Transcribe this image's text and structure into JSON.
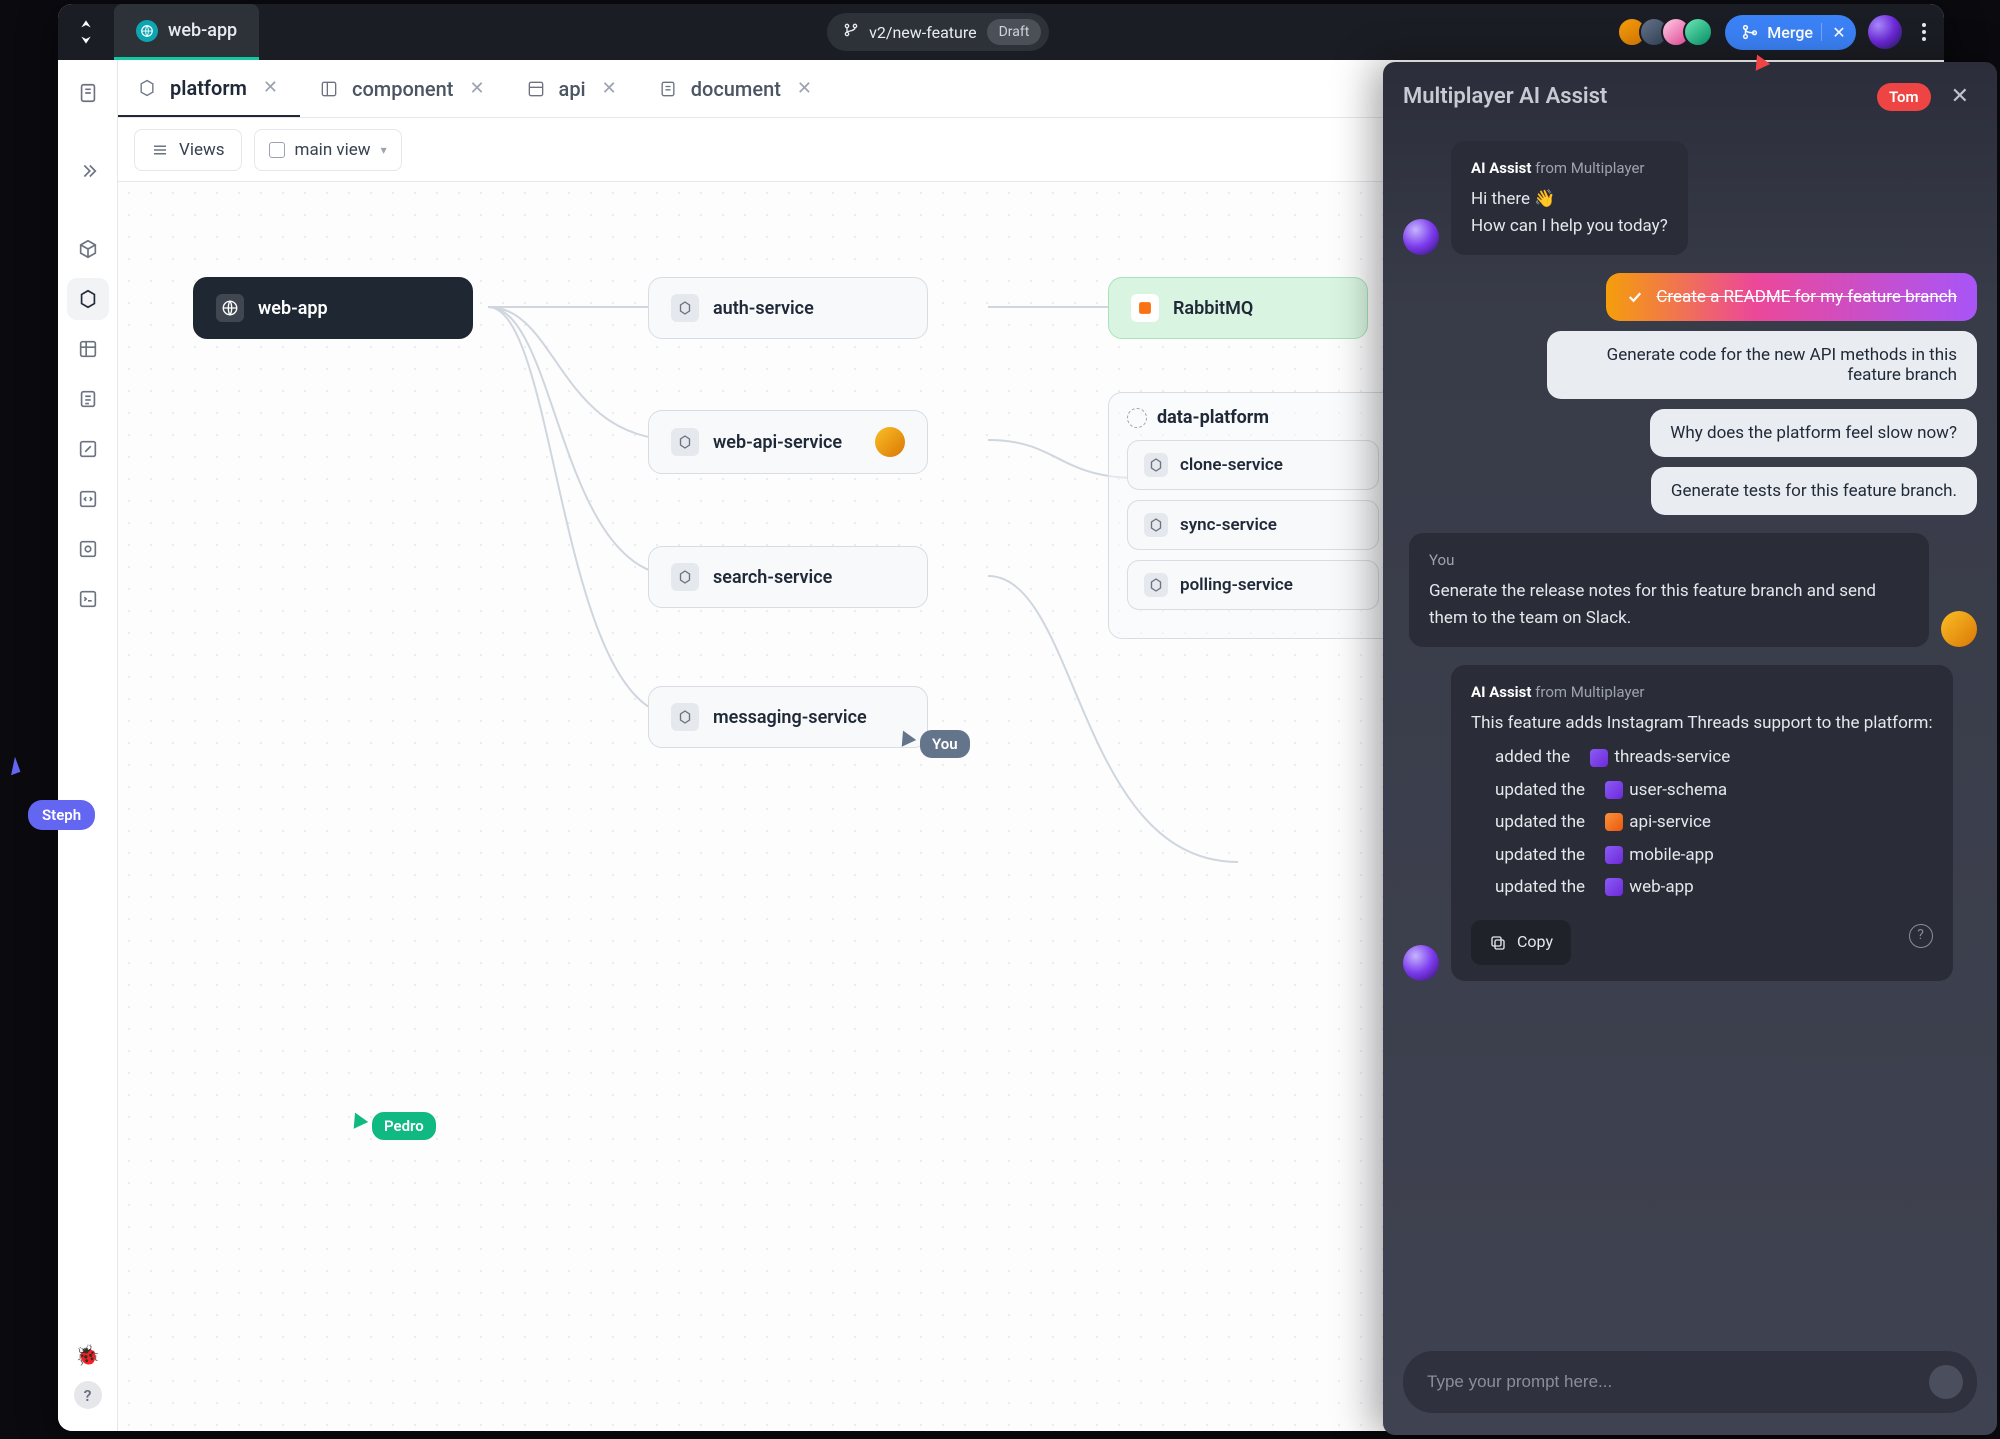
{
  "topbar": {
    "app_title": "web-app",
    "branch": "v2/new-feature",
    "draft_label": "Draft",
    "merge_label": "Merge"
  },
  "file_tabs": [
    {
      "label": "platform",
      "active": true
    },
    {
      "label": "component",
      "active": false
    },
    {
      "label": "api",
      "active": false
    },
    {
      "label": "document",
      "active": false
    }
  ],
  "toolbar": {
    "views_label": "Views",
    "view_name": "main view"
  },
  "nodes": {
    "web_app": "web-app",
    "auth_service": "auth-service",
    "web_api_service": "web-api-service",
    "search_service": "search-service",
    "messaging_service": "messaging-service",
    "rabbitmq": "RabbitMQ",
    "data_platform": "data-platform",
    "clone_service": "clone-service",
    "sync_service": "sync-service",
    "polling_service": "polling-service"
  },
  "cursors": {
    "pedro": "Pedro",
    "you": "You",
    "steph": "Steph",
    "tom": "Tom"
  },
  "assist": {
    "title": "Multiplayer AI Assist",
    "tom_badge": "Tom",
    "ai_from_name": "AI Assist",
    "ai_from_suffix": "from Multiplayer",
    "greeting_l1": "Hi there 👋",
    "greeting_l2": "How can I help you today?",
    "suggestions": [
      "Create a README for my feature branch",
      "Generate code for the new API methods in this feature branch",
      "Why does the platform feel slow now?",
      "Generate tests for this feature branch."
    ],
    "you_label": "You",
    "you_msg": "Generate the release notes for this feature branch and send them to the team on Slack.",
    "release_intro": "This feature adds Instagram Threads support to the platform:",
    "release_items": [
      {
        "prefix": "added the",
        "file": "threads-service",
        "color": "purple"
      },
      {
        "prefix": "updated the",
        "file": "user-schema",
        "color": "purple"
      },
      {
        "prefix": "updated the",
        "file": "api-service",
        "color": "orange"
      },
      {
        "prefix": "updated the",
        "file": "mobile-app",
        "color": "purple"
      },
      {
        "prefix": "updated the",
        "file": "web-app",
        "color": "purple"
      }
    ],
    "copy_label": "Copy",
    "input_placeholder": "Type your prompt here..."
  }
}
